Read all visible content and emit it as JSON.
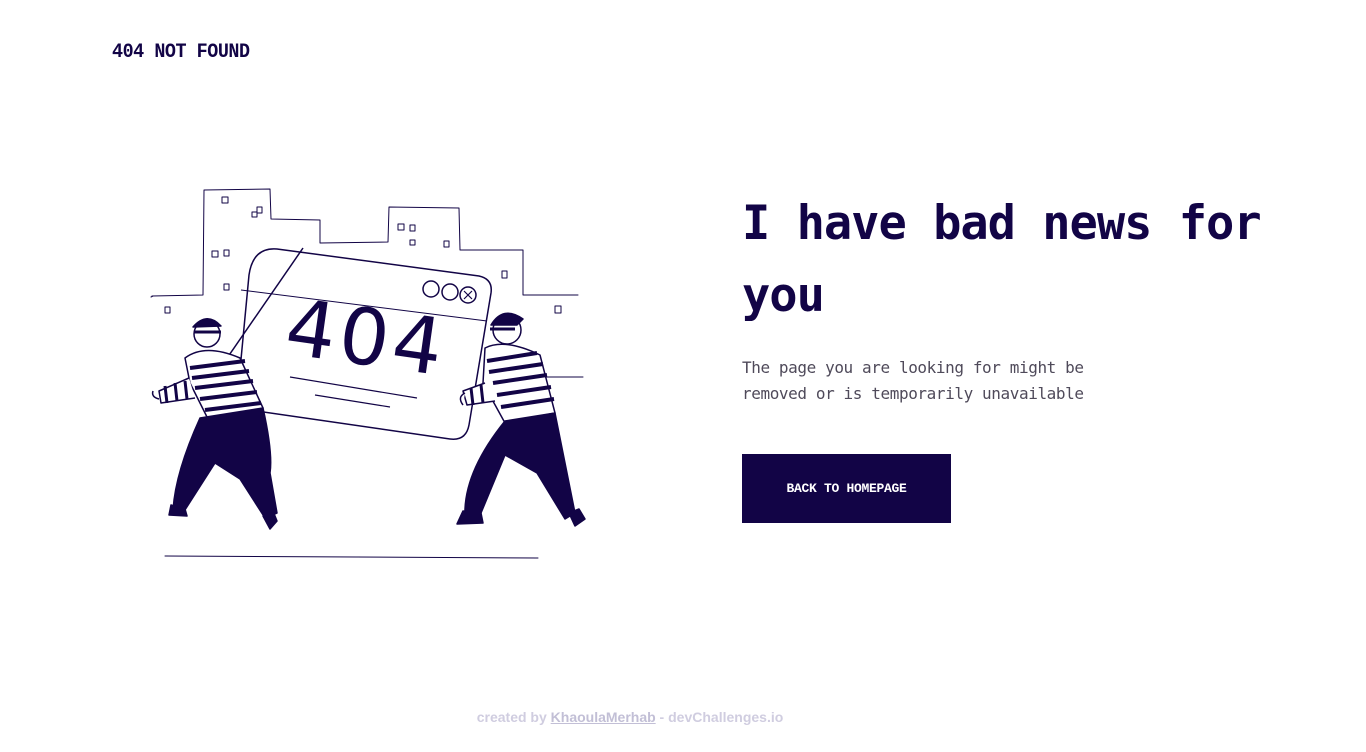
{
  "header": {
    "logo_text": "404 NOT FOUND"
  },
  "illustration": {
    "screen_text": "404",
    "icon": "two-thieves-carrying-browser-window-illustration"
  },
  "main": {
    "headline": "I have bad news for you",
    "description": "The page you are looking for might be removed or is temporarily unavailable",
    "button_label": "BACK TO HOMEPAGE"
  },
  "footer": {
    "prefix": "created by",
    "author_link": "KhaoulaMerhab",
    "separator": " - ",
    "site": "devChallenges.io"
  },
  "colors": {
    "primary": "#120446",
    "text_muted": "#4f4a5a",
    "footer_text": "#d0cde0",
    "background": "#ffffff"
  }
}
